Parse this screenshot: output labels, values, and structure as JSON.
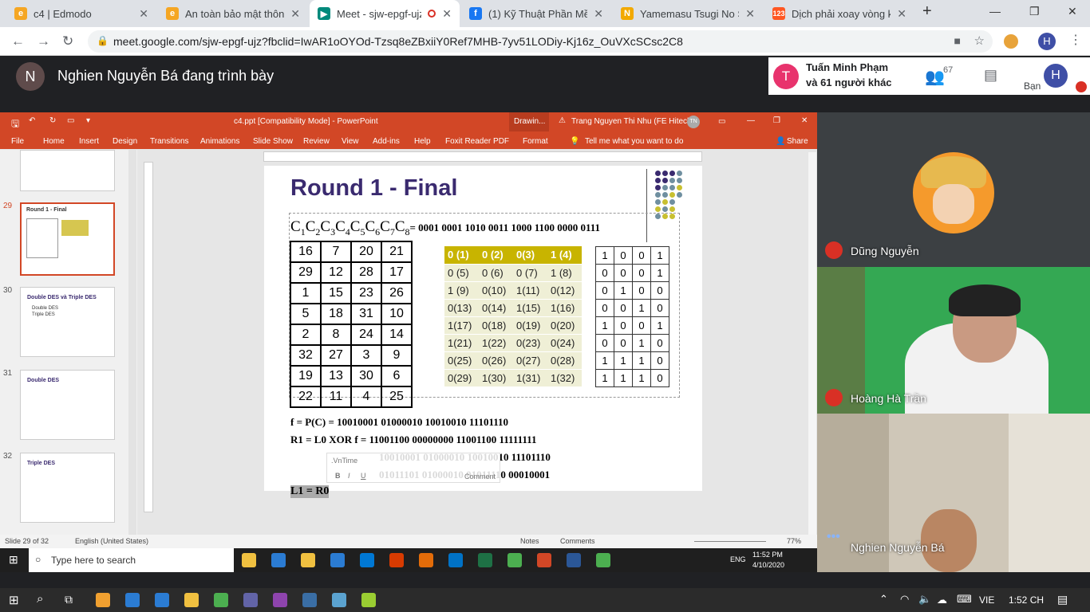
{
  "browser": {
    "tabs": [
      {
        "title": "c4 | Edmodo",
        "icon": "edmodo-icon",
        "color": "#f5a623"
      },
      {
        "title": "An toàn bảo mật thông",
        "icon": "edmodo-icon",
        "color": "#f5a623"
      },
      {
        "title": "Meet - sjw-epgf-ujz",
        "icon": "meet-icon",
        "color": "#00897b"
      },
      {
        "title": "(1) Kỹ Thuật Phần Mềm",
        "icon": "facebook-icon",
        "color": "#1877f2"
      },
      {
        "title": "Yamemasu Tsugi No Sh",
        "icon": "n-icon",
        "color": "#f2a900"
      },
      {
        "title": "Dịch phải xoay vòng k",
        "icon": "123-icon",
        "color": "#ff5722"
      }
    ],
    "url": "meet.google.com/sjw-epgf-ujz?fbclid=IwAR1oOYOd-Tzsq8eZBxiiY0Ref7MHB-7yv51LODiy-Kj16z_OuVXcSCsc2C8",
    "profile": "H"
  },
  "meet": {
    "presenter_initial": "N",
    "presenting_text": "Nghien Nguyễn Bá đang trình bày",
    "participant_initial": "T",
    "participant_line1": "Tuấn Minh Phạm",
    "participant_line2": "và 61 người khác",
    "participant_count": "67",
    "you_label": "Bạn",
    "you_initial": "H",
    "tiles": [
      {
        "name": "Dũng Nguyễn",
        "muted": true
      },
      {
        "name": "Hoàng Hà Trần",
        "muted": true
      },
      {
        "name": "Nghien Nguyễn Bá",
        "muted": false
      }
    ]
  },
  "ppt": {
    "title": "c4.ppt [Compatibility Mode]  -  PowerPoint",
    "drawing_tab": "Drawin...",
    "warning": "Trang Nguyen Thi Nhu (FE Hitech)",
    "user_initials": "TN",
    "menu": [
      "File",
      "Home",
      "Insert",
      "Design",
      "Transitions",
      "Animations",
      "Slide Show",
      "Review",
      "View",
      "Add-ins",
      "Help",
      "Foxit Reader PDF",
      "Format"
    ],
    "tell_me": "Tell me what you want to do",
    "share": "Share",
    "status_slide": "Slide 29 of 32",
    "status_lang": "English (United States)",
    "notes": "Notes",
    "comments": "Comments",
    "zoom": "77%",
    "thumbs": [
      {
        "num": "29",
        "title": "Round 1 - Final"
      },
      {
        "num": "30",
        "title": "Double DES và Triple DES",
        "lines": [
          "Double DES",
          "Triple DES"
        ]
      },
      {
        "num": "31",
        "title": "Double DES"
      },
      {
        "num": "32",
        "title": "Triple DES"
      }
    ],
    "float_font": ".VnTime",
    "float_label": "Comment"
  },
  "slide": {
    "title": "Round 1 - Final",
    "c_label": "C1C2C3C4C5C6C7C8",
    "c_value": "= 0001 0001 1010 0011 1000 1100 0000 0111",
    "ptable": [
      [
        "16",
        "7",
        "20",
        "21"
      ],
      [
        "29",
        "12",
        "28",
        "17"
      ],
      [
        "1",
        "15",
        "23",
        "26"
      ],
      [
        "5",
        "18",
        "31",
        "10"
      ],
      [
        "2",
        "8",
        "24",
        "14"
      ],
      [
        "32",
        "27",
        "3",
        "9"
      ],
      [
        "19",
        "13",
        "30",
        "6"
      ],
      [
        "22",
        "11",
        "4",
        "25"
      ]
    ],
    "yheader": [
      "0 (1)",
      "0 (2)",
      "0(3)",
      "1 (4)"
    ],
    "yrows": [
      [
        "0 (5)",
        "0 (6)",
        "0 (7)",
        "1 (8)"
      ],
      [
        "1 (9)",
        "0(10)",
        "1(11)",
        "0(12)"
      ],
      [
        "0(13)",
        "0(14)",
        "1(15)",
        "1(16)"
      ],
      [
        "1(17)",
        "0(18)",
        "0(19)",
        "0(20)"
      ],
      [
        "1(21)",
        "1(22)",
        "0(23)",
        "0(24)"
      ],
      [
        "0(25)",
        "0(26)",
        "0(27)",
        "0(28)"
      ],
      [
        "0(29)",
        "1(30)",
        "1(31)",
        "1(32)"
      ]
    ],
    "btable": [
      [
        "1",
        "0",
        "0",
        "1"
      ],
      [
        "0",
        "0",
        "0",
        "1"
      ],
      [
        "0",
        "1",
        "0",
        "0"
      ],
      [
        "0",
        "0",
        "1",
        "0"
      ],
      [
        "1",
        "0",
        "0",
        "1"
      ],
      [
        "0",
        "0",
        "1",
        "0"
      ],
      [
        "1",
        "1",
        "1",
        "0"
      ],
      [
        "1",
        "1",
        "1",
        "0"
      ]
    ],
    "f_line": "f = P(C) = 10010001 01000010 10010010 11101110",
    "r_line": "R1 = L0 XOR f = 11001100 00000000 11001100 11111111",
    "line3": "10010001 01000010 10010010 11101110",
    "line4": "01011101 01000010 01011110 00010001",
    "l_line": "L1 = R0"
  },
  "taskbar_inner": {
    "search": "Type here to search",
    "lang": "ENG",
    "time": "11:52 PM",
    "date": "4/10/2020"
  },
  "taskbar_outer": {
    "lang": "VIE",
    "time": "1:52 CH"
  }
}
